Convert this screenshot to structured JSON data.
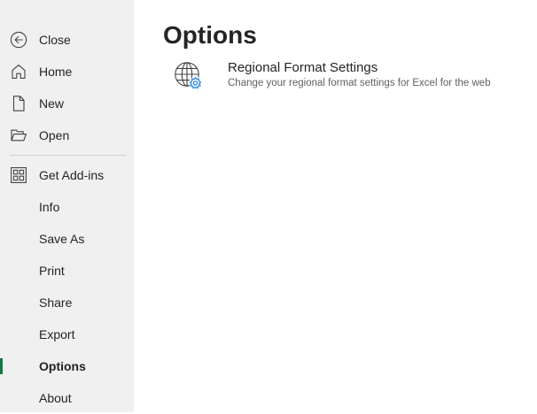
{
  "sidebar": {
    "items": [
      {
        "label": "Close",
        "icon": "back-arrow-circle-icon"
      },
      {
        "label": "Home",
        "icon": "home-icon"
      },
      {
        "label": "New",
        "icon": "new-document-icon"
      },
      {
        "label": "Open",
        "icon": "folder-open-icon"
      },
      {
        "label": "Get Add-ins",
        "icon": "add-ins-grid-icon"
      },
      {
        "label": "Info"
      },
      {
        "label": "Save As"
      },
      {
        "label": "Print"
      },
      {
        "label": "Share"
      },
      {
        "label": "Export"
      },
      {
        "label": "Options",
        "selected": true
      },
      {
        "label": "About"
      }
    ]
  },
  "main": {
    "title": "Options",
    "options": [
      {
        "title": "Regional Format Settings",
        "description": "Change your regional format settings for Excel for the web",
        "icon": "globe-gear-icon"
      }
    ]
  },
  "colors": {
    "sidebar_bg": "#f0f0f0",
    "selected_accent": "#107c41",
    "gear_accent": "#2b88d8",
    "text": "#242424",
    "secondary_text": "#616161"
  }
}
